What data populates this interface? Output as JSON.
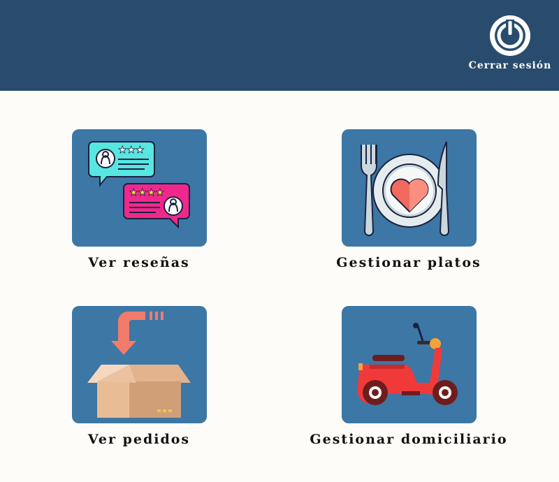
{
  "header": {
    "background": "#294c6e",
    "logout": {
      "label": "Cerrar sesión",
      "icon": "power-icon"
    }
  },
  "menu": [
    {
      "id": "reviews",
      "label": "Ver reseñas",
      "icon": "reviews-icon"
    },
    {
      "id": "dishes",
      "label": "Gestionar platos",
      "icon": "plate-cutlery-icon"
    },
    {
      "id": "orders",
      "label": "Ver pedidos",
      "icon": "package-box-icon"
    },
    {
      "id": "couriers",
      "label": "Gestionar domiciliario",
      "icon": "scooter-icon"
    }
  ],
  "colors": {
    "tile": "#3c77a6",
    "page": "#fdfcf8",
    "text": "#111111"
  }
}
